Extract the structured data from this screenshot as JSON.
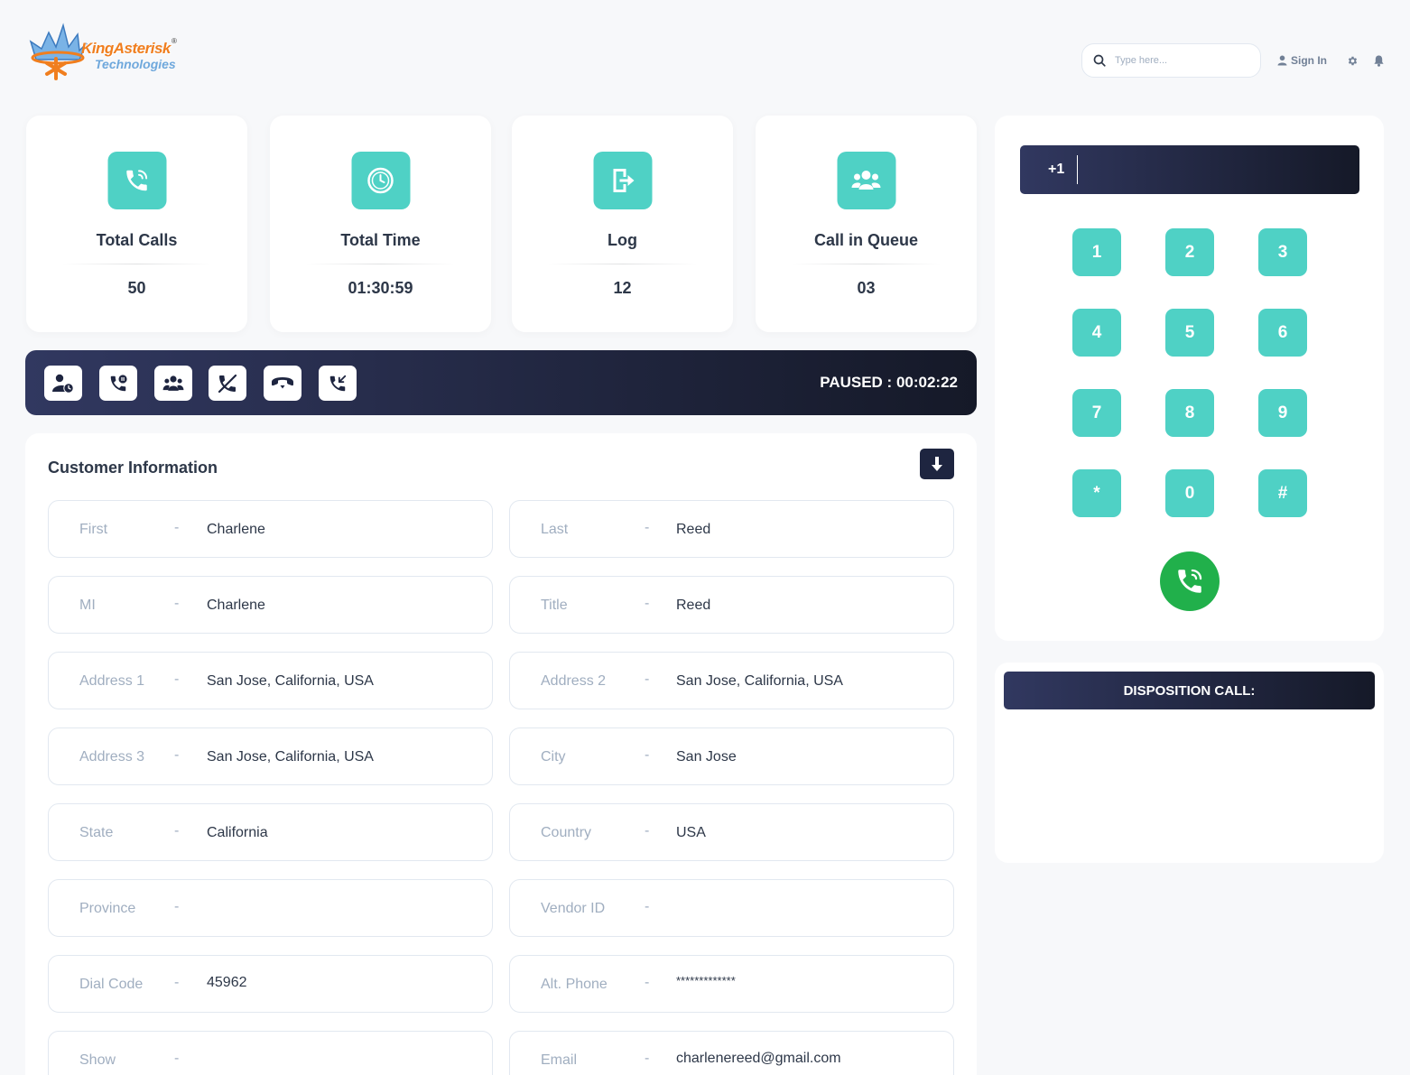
{
  "header": {
    "logo_text_1": "KingAsterisk",
    "logo_reg": "®",
    "logo_text_2": "Technologies",
    "search_placeholder": "Type here...",
    "signin_label": "Sign In"
  },
  "stats": [
    {
      "title": "Total Calls",
      "value": "50",
      "icon": "phone-call-icon"
    },
    {
      "title": "Total Time",
      "value": "01:30:59",
      "icon": "clock-icon"
    },
    {
      "title": "Log",
      "value": "12",
      "icon": "logout-icon"
    },
    {
      "title": "Call in Queue",
      "value": "03",
      "icon": "users-icon"
    }
  ],
  "actionbar": {
    "buttons": [
      "user-clock-icon",
      "phone-pause-icon",
      "users-group-icon",
      "phone-slash-icon",
      "hangup-icon",
      "incoming-call-icon"
    ],
    "status": "PAUSED : 00:02:22"
  },
  "customer": {
    "title": "Customer Information",
    "dash": "-",
    "fields": [
      {
        "label": "First",
        "value": "Charlene"
      },
      {
        "label": "Last",
        "value": "Reed"
      },
      {
        "label": "MI",
        "value": "Charlene"
      },
      {
        "label": "Title",
        "value": "Reed"
      },
      {
        "label": "Address 1",
        "value": "San Jose, California, USA"
      },
      {
        "label": "Address 2",
        "value": "San Jose, California, USA"
      },
      {
        "label": "Address 3",
        "value": "San Jose, California, USA"
      },
      {
        "label": "City",
        "value": "San Jose"
      },
      {
        "label": "State",
        "value": "California"
      },
      {
        "label": "Country",
        "value": "USA"
      },
      {
        "label": "Province",
        "value": ""
      },
      {
        "label": "Vendor ID",
        "value": ""
      },
      {
        "label": "Dial Code",
        "value": "45962"
      },
      {
        "label": "Alt. Phone",
        "value": "*************"
      },
      {
        "label": "Show",
        "value": ""
      },
      {
        "label": "Email",
        "value": "charlenereed@gmail.com"
      }
    ]
  },
  "dialer": {
    "country_code": "+1",
    "keys": [
      "1",
      "2",
      "3",
      "4",
      "5",
      "6",
      "7",
      "8",
      "9",
      "*",
      "0",
      "#"
    ]
  },
  "disposition": {
    "title": "DISPOSITION CALL:"
  },
  "colors": {
    "accent": "#4fd1c5",
    "dark": "#1e2540",
    "call_green": "#21b04b",
    "brand_orange": "#f07e1e"
  }
}
